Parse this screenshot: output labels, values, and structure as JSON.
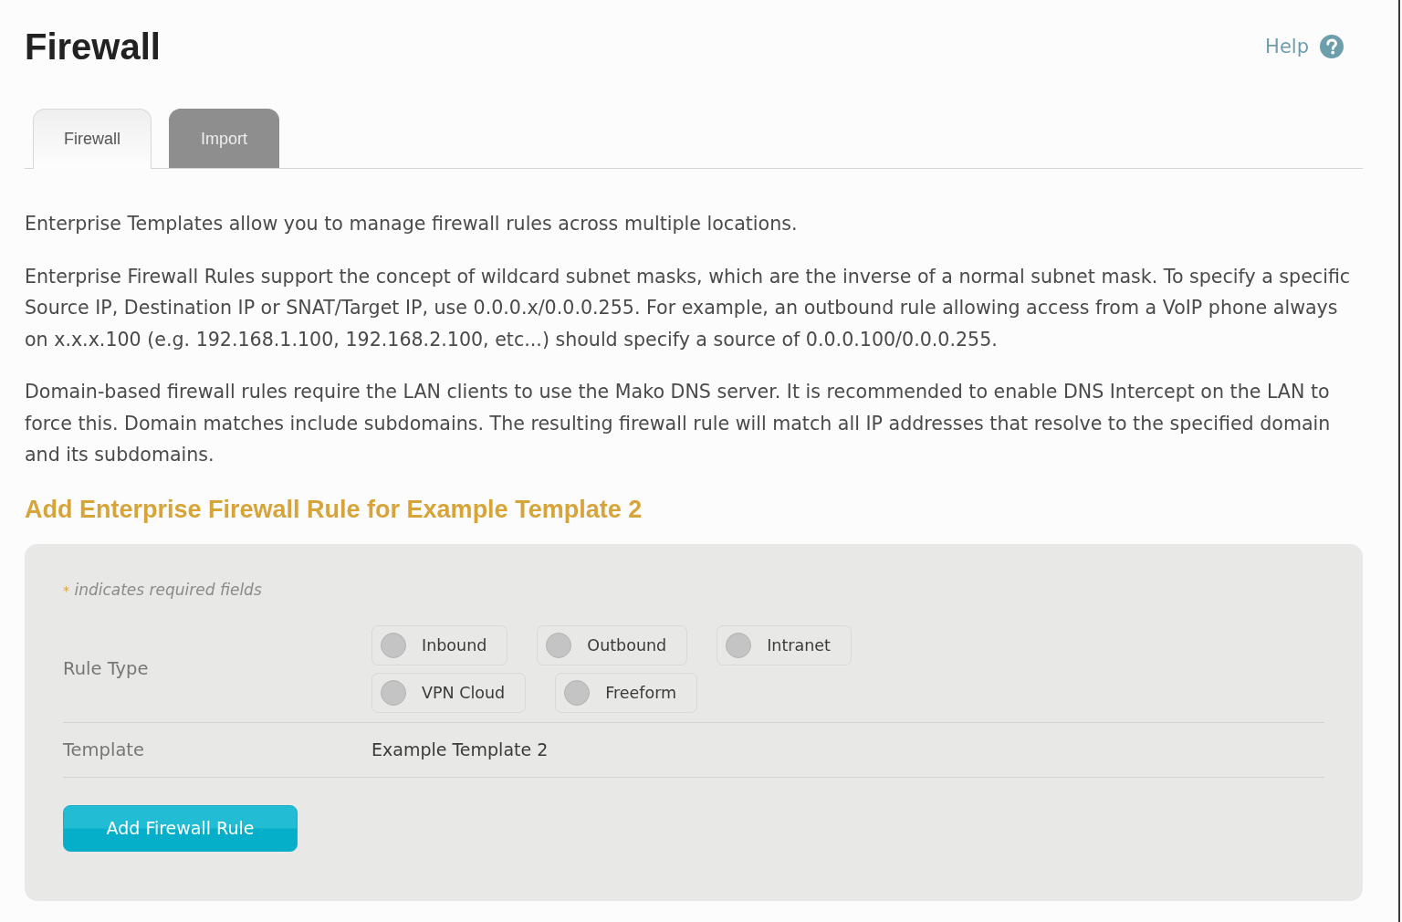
{
  "page": {
    "title": "Firewall",
    "help_link": "Help"
  },
  "tabs": [
    {
      "label": "Firewall",
      "selected": true
    },
    {
      "label": "Import",
      "selected": false
    }
  ],
  "intro_paragraphs": [
    "Enterprise Templates allow you to manage firewall rules across multiple locations.",
    "Enterprise Firewall Rules support the concept of wildcard subnet masks, which are the inverse of a normal subnet mask. To specify a specific Source IP, Destination IP or SNAT/Target IP, use 0.0.0.x/0.0.0.255. For example, an outbound rule allowing access from a VoIP phone always on x.x.x.100 (e.g. 192.168.1.100, 192.168.2.100, etc...) should specify a source of 0.0.0.100/0.0.0.255.",
    "Domain-based firewall rules require the LAN clients to use the Mako DNS server. It is recommended to enable DNS Intercept on the LAN to force this. Domain matches include subdomains. The resulting firewall rule will match all IP addresses that resolve to the specified domain and its subdomains."
  ],
  "form": {
    "heading": "Add Enterprise Firewall Rule for Example Template 2",
    "required_note": {
      "marker": "*",
      "text": "indicates required fields"
    },
    "fields": [
      {
        "kind": "radio_group",
        "label": "Rule Type",
        "options": [
          {
            "label": "Inbound",
            "selected": false
          },
          {
            "label": "Outbound",
            "selected": false
          },
          {
            "label": "Intranet",
            "selected": false
          },
          {
            "label": "VPN Cloud",
            "selected": false
          },
          {
            "label": "Freeform",
            "selected": false
          }
        ]
      },
      {
        "kind": "static",
        "label": "Template",
        "value": "Example Template 2"
      }
    ],
    "submit_button": "Add Firewall Rule"
  }
}
